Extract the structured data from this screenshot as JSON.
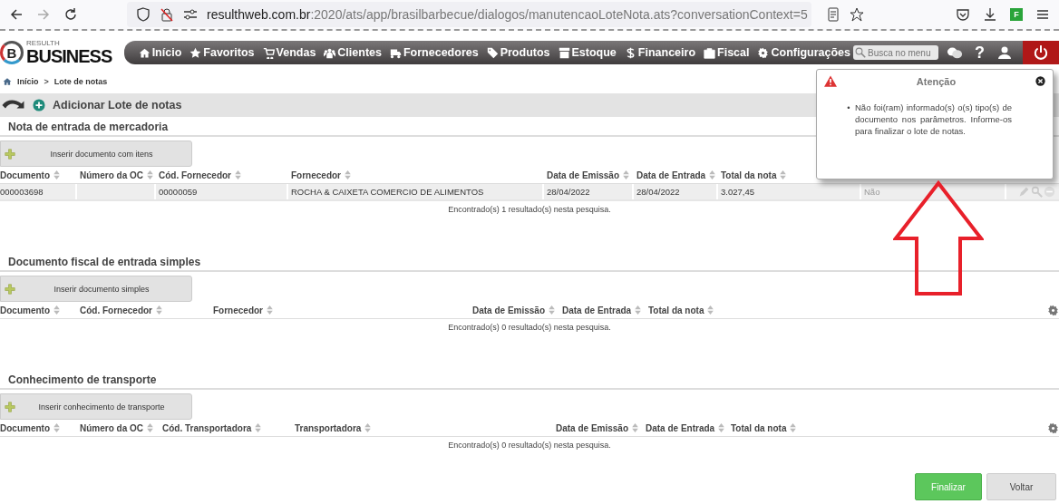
{
  "browser": {
    "url_host": "resulthweb.com.br",
    "url_path": ":2020/ats/app/brasilbarbecue/dialogos/manutencaoLoteNota.ats?conversationContext=5",
    "extension_badge": "F"
  },
  "header": {
    "logo_mark": "B",
    "logo_small": "RESULTH",
    "logo_big": "BUSINESS",
    "nav": [
      {
        "kind": "home",
        "label": "Início"
      },
      {
        "kind": "star",
        "label": "Favoritos"
      },
      {
        "kind": "cart",
        "label": "Vendas"
      },
      {
        "kind": "people",
        "label": "Clientes"
      },
      {
        "kind": "truck",
        "label": "Fornecedores"
      },
      {
        "kind": "tag",
        "label": "Produtos"
      },
      {
        "kind": "box",
        "label": "Estoque"
      },
      {
        "kind": "dollar",
        "label": "Financeiro"
      },
      {
        "kind": "briefcase",
        "label": "Fiscal"
      },
      {
        "kind": "gear",
        "label": "Configurações"
      }
    ],
    "search": {
      "placeholder": "Busca no menu"
    },
    "help": "?"
  },
  "breadcrumb": {
    "items": [
      "Início",
      "Lote de notas"
    ],
    "separator": ">"
  },
  "toolbar": {
    "title": "Adicionar Lote de notas"
  },
  "sections": [
    {
      "title": "Nota de entrada de mercadoria",
      "button": "Inserir documento com itens",
      "settings_icon": false,
      "columns": [
        "Documento",
        "Número da OC",
        "Cód. Fornecedor",
        "Fornecedor",
        "Data de Emissão",
        "Data de Entrada",
        "Total da nota"
      ],
      "rows": [
        {
          "cells": [
            "000003698",
            "",
            "00000059",
            "ROCHA & CAIXETA COMERCIO DE ALIMENTOS",
            "28/04/2022",
            "28/04/2022",
            "3.027,45",
            "Não"
          ]
        }
      ],
      "found": "Encontrado(s) 1 resultado(s) nesta pesquisa."
    },
    {
      "title": "Documento fiscal de entrada simples",
      "button": "Inserir documento simples",
      "settings_icon": true,
      "columns": [
        "Documento",
        "Cód. Fornecedor",
        "Fornecedor",
        "Data de Emissão",
        "Data de Entrada",
        "Total da nota"
      ],
      "found": "Encontrado(s) 0 resultado(s) nesta pesquisa."
    },
    {
      "title": "Conhecimento de transporte",
      "button": "Inserir conhecimento de transporte",
      "settings_icon": true,
      "columns": [
        "Documento",
        "Número da OC",
        "Cód. Transportadora",
        "Transportadora",
        "Data de Emissão",
        "Data de Entrada",
        "Total da nota"
      ],
      "found": "Encontrado(s) 0 resultado(s) nesta pesquisa."
    }
  ],
  "footer_buttons": [
    {
      "kind": "primary",
      "label": "Finalizar"
    },
    {
      "kind": "secondary",
      "label": "Voltar"
    }
  ],
  "alert": {
    "title": "Atenção",
    "bullet": "•",
    "messages": [
      "Não foi(ram) informado(s) o(s) tipo(s) de documento nos parâmetros. Informe-os para finalizar o lote de notas."
    ]
  }
}
